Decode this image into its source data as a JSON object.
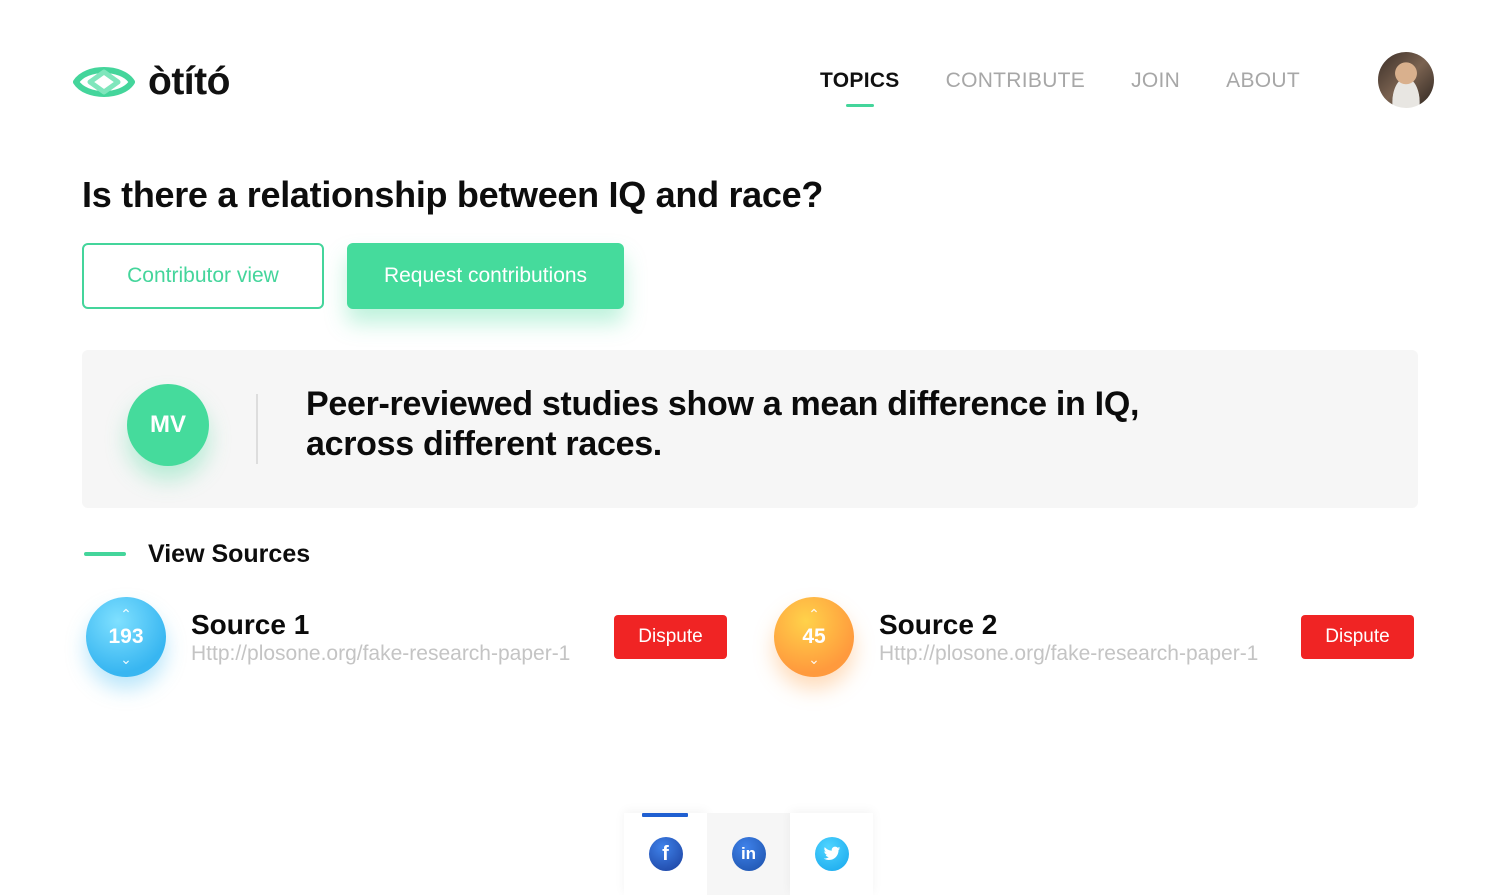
{
  "brand": {
    "name": "òtító",
    "accent": "#44d59b"
  },
  "nav": {
    "items": [
      {
        "label": "TOPICS",
        "active": true
      },
      {
        "label": "CONTRIBUTE",
        "active": false
      },
      {
        "label": "JOIN",
        "active": false
      },
      {
        "label": "ABOUT",
        "active": false
      }
    ]
  },
  "topic": {
    "question": "Is there a relationship between IQ and race?",
    "contributor_view_label": "Contributor view",
    "request_contributions_label": "Request contributions"
  },
  "claim": {
    "author_initials": "MV",
    "text": "Peer-reviewed studies show a mean difference in IQ, across different races."
  },
  "sources": {
    "heading": "View Sources",
    "items": [
      {
        "score": "193",
        "title": "Source 1",
        "url": "Http://plosone.org/fake-research-paper-1",
        "dispute_label": "Dispute",
        "color": "#38b6f1"
      },
      {
        "score": "45",
        "title": "Source 2",
        "url": "Http://plosone.org/fake-research-paper-1",
        "dispute_label": "Dispute",
        "color": "#ff9a3d"
      }
    ]
  },
  "share": {
    "items": [
      {
        "icon": "facebook-icon",
        "glyph": "f",
        "active": true
      },
      {
        "icon": "linkedin-icon",
        "glyph": "in",
        "active": false
      },
      {
        "icon": "twitter-icon",
        "glyph": "",
        "active": false
      }
    ]
  }
}
